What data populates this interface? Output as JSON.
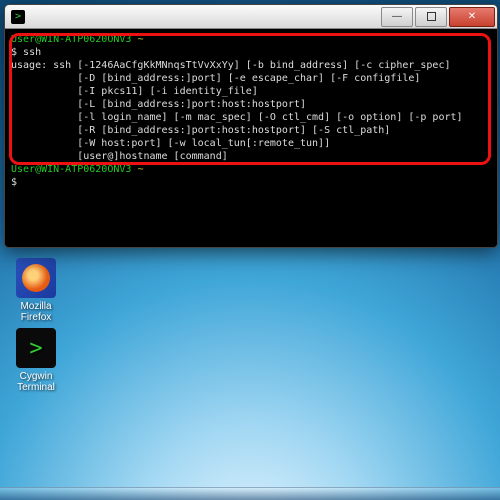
{
  "desktop": {
    "icons": [
      {
        "label": "Mozilla Firefox"
      },
      {
        "label": "Cygwin Terminal",
        "glyph": ">"
      }
    ]
  },
  "window": {
    "app_glyph": ">"
  },
  "terminal": {
    "prompt1_user": "User@WIN-ATP0620ONV3",
    "prompt1_tilde": "~",
    "cmd1": "ssh",
    "usage": [
      "usage: ssh [-1246AaCfgKkMNnqsTtVvXxYy] [-b bind_address] [-c cipher_spec]",
      "           [-D [bind_address:]port] [-e escape_char] [-F configfile]",
      "           [-I pkcs11] [-i identity_file]",
      "           [-L [bind_address:]port:host:hostport]",
      "           [-l login_name] [-m mac_spec] [-O ctl_cmd] [-o option] [-p port]",
      "           [-R [bind_address:]port:host:hostport] [-S ctl_path]",
      "           [-W host:port] [-w local_tun[:remote_tun]]",
      "           [user@]hostname [command]"
    ],
    "prompt2_user": "User@WIN-ATP0620ONV3",
    "prompt2_tilde": "~",
    "prompt3": "$"
  }
}
